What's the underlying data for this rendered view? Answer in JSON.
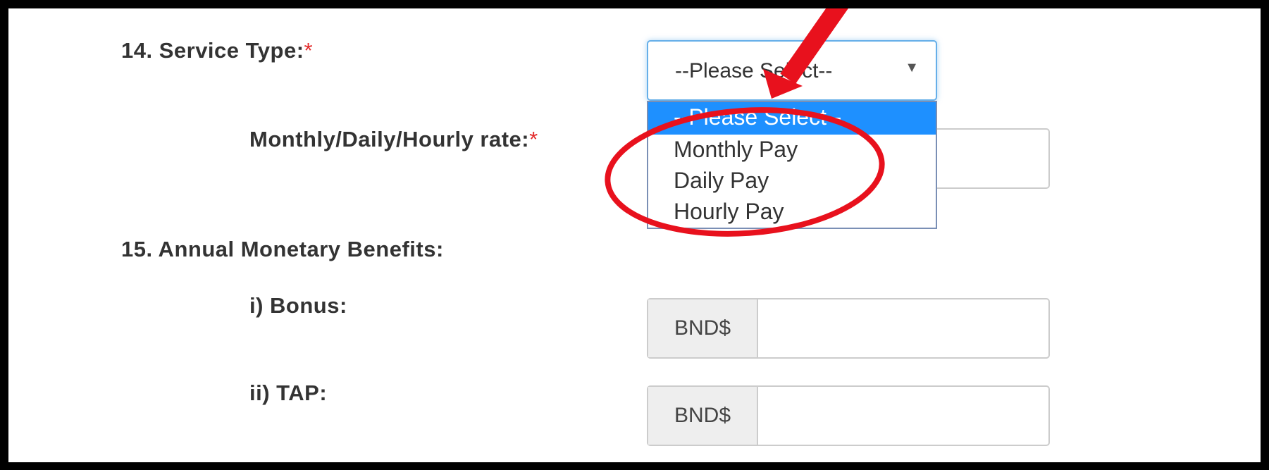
{
  "form": {
    "q14_label": "14. Service Type:",
    "q14_required": "*",
    "service_select": {
      "value": "--Please Select--",
      "caret": "▼",
      "options": [
        "--Please Select--",
        "Monthly Pay",
        "Daily Pay",
        "Hourly Pay"
      ],
      "highlighted_option": "--Please Select--"
    },
    "rate_label": "Monthly/Daily/Hourly rate:",
    "rate_required": "*",
    "q15_label": "15. Annual Monetary Benefits:",
    "bonus_label": "i) Bonus:",
    "bonus_prefix": "BND$",
    "bonus_value": "",
    "tap_label": "ii) TAP:",
    "tap_prefix": "BND$",
    "tap_value": ""
  },
  "annotations": {
    "arrow_color": "#e8111d",
    "ellipse_color": "#e8111d"
  }
}
